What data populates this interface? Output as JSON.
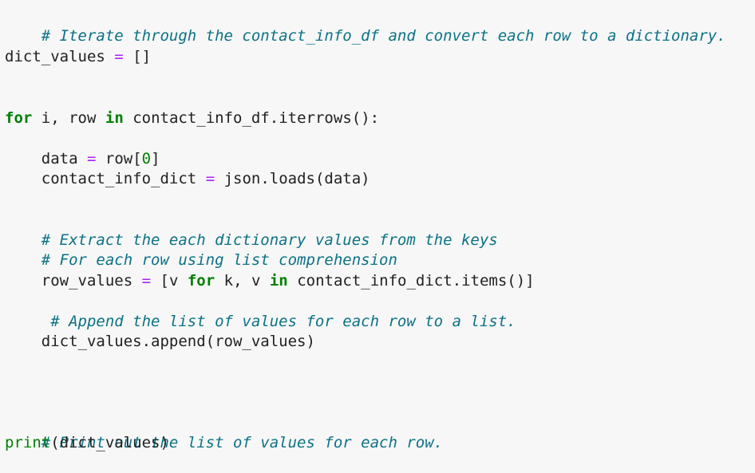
{
  "code": {
    "line_1_comment": "# Iterate through the contact_info_df and convert each row to a dictionary.",
    "line_2_name": "dict_values",
    "line_2_op": "=",
    "line_2_value": "[]",
    "line_3_kw_for": "for",
    "line_3_vars": "i, row",
    "line_3_kw_in": "in",
    "line_3_call": "contact_info_df.iterrows():",
    "line_4_name": "data",
    "line_4_op": "=",
    "line_4_pre": "row[",
    "line_4_num": "0",
    "line_4_post": "]",
    "line_5_name": "contact_info_dict",
    "line_5_op": "=",
    "line_5_call": "json.loads(data)",
    "line_6_comment": "# Extract the each dictionary values from the keys",
    "line_7_comment": "# For each row using list comprehension",
    "line_8_name": "row_values",
    "line_8_op": "=",
    "line_8_open": "[v",
    "line_8_kw_for": "for",
    "line_8_vars": "k, v",
    "line_8_kw_in": "in",
    "line_8_call": "contact_info_dict.items()]",
    "line_9_comment": "# Append the list of values for each row to a list.",
    "line_10_call": "dict_values.append(row_values)",
    "line_11_comment": "# Print out the list of values for each row.",
    "line_12_builtin": "print",
    "line_12_args": "(dict_values)"
  }
}
